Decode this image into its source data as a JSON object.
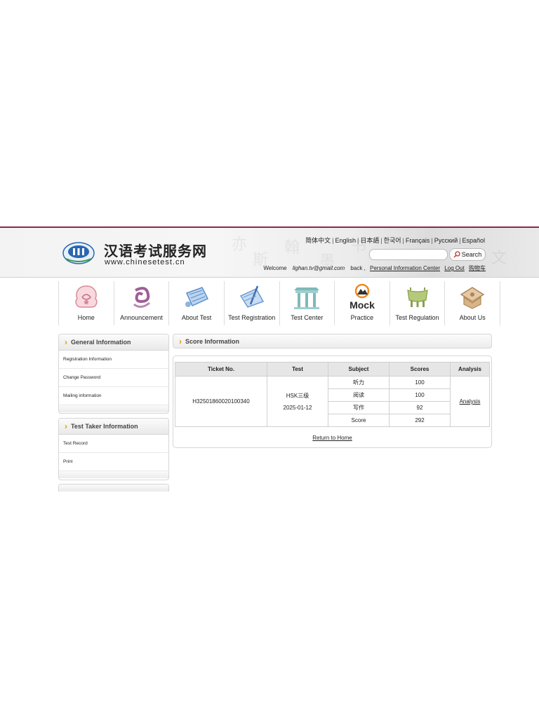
{
  "header": {
    "site_title": "汉语考试服务网",
    "site_url": "www.chinesetest.cn",
    "languages": [
      "简体中文",
      "English",
      "日本語",
      "한국어",
      "Français",
      "Русский",
      "Español"
    ],
    "search_button": "Search",
    "welcome": "Welcome",
    "user_email": "lighan.tv@gmail.com",
    "back": "back ,",
    "personal_center": "Personal Information Center",
    "logout": "Log Out",
    "shopping_cart": "购物车"
  },
  "nav": [
    {
      "label": "Home",
      "icon": "home-icon"
    },
    {
      "label": "Announcement",
      "icon": "announcement-icon"
    },
    {
      "label": "About Test",
      "icon": "about-test-icon"
    },
    {
      "label": "Test Registration",
      "icon": "test-registration-icon"
    },
    {
      "label": "Test Center",
      "icon": "test-center-icon"
    },
    {
      "label": "Practice",
      "icon": "mock-icon",
      "icon_text": "Mock"
    },
    {
      "label": "Test Regulation",
      "icon": "test-regulation-icon"
    },
    {
      "label": "About Us",
      "icon": "about-us-icon"
    }
  ],
  "sidebar": {
    "general": {
      "title": "General Information",
      "items": [
        "Registration Information",
        "Change Password",
        "Mailing information"
      ]
    },
    "test_taker": {
      "title": "Test Taker Information",
      "items": [
        "Test Record",
        "Print"
      ]
    }
  },
  "score": {
    "title": "Score Information",
    "columns": [
      "Ticket No.",
      "Test",
      "Subject",
      "Scores",
      "Analysis"
    ],
    "ticket_no": "H32501860020100340",
    "test_name": "HSK三级",
    "test_date": "2025-01-12",
    "rows": [
      {
        "subject": "听力",
        "score": "100"
      },
      {
        "subject": "阅读",
        "score": "100"
      },
      {
        "subject": "写作",
        "score": "92"
      },
      {
        "subject": "Score",
        "score": "292"
      }
    ],
    "analysis_link": "Analysis",
    "return_home": "Return to Home"
  },
  "colors": {
    "top_line": "#8a2a45",
    "chevron": "#e89a00",
    "logo_blue": "#2a66b0",
    "logo_green": "#3a9a4a"
  }
}
